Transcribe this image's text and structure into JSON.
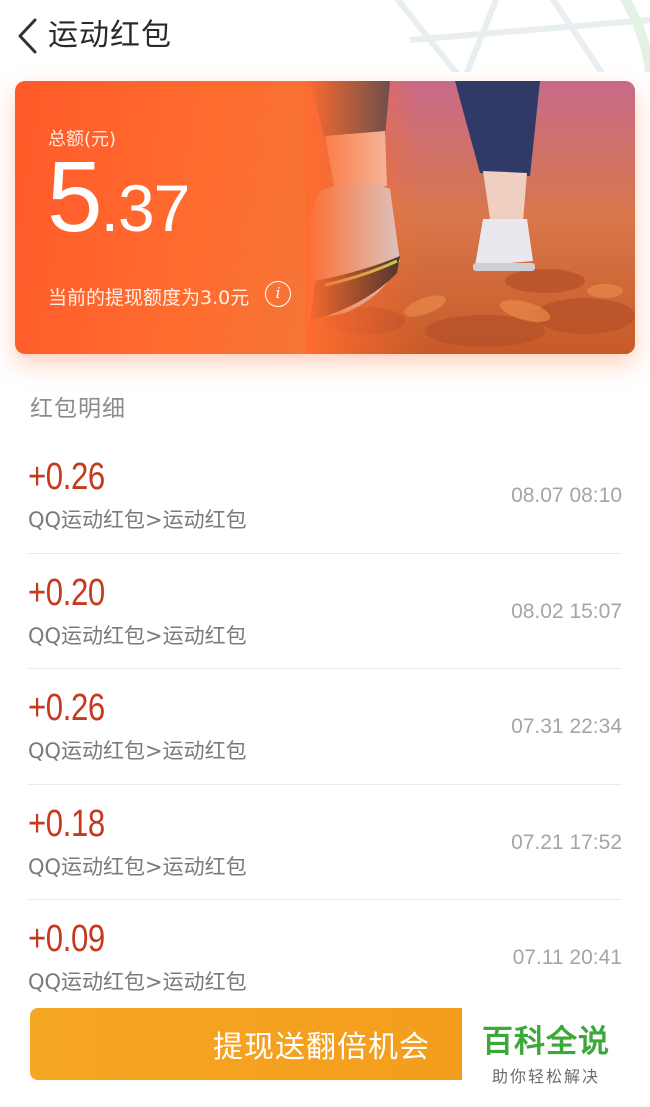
{
  "header": {
    "title": "运动红包",
    "back_icon": "chevron-left-icon"
  },
  "card": {
    "total_label": "总额(元)",
    "amount_int": "5",
    "amount_dec": ".37",
    "limit_text": "当前的提现额度为3.0元",
    "info_icon": "info-icon",
    "accent_color": "#ff5a2a"
  },
  "section": {
    "title": "红包明细"
  },
  "records": [
    {
      "amount": "+0.26",
      "source": "QQ运动红包>运动红包",
      "time": "08.07 08:10"
    },
    {
      "amount": "+0.20",
      "source": "QQ运动红包>运动红包",
      "time": "08.02 15:07"
    },
    {
      "amount": "+0.26",
      "source": "QQ运动红包>运动红包",
      "time": "07.31 22:34"
    },
    {
      "amount": "+0.18",
      "source": "QQ运动红包>运动红包",
      "time": "07.21 17:52"
    },
    {
      "amount": "+0.09",
      "source": "QQ运动红包>运动红包",
      "time": "07.11 20:41"
    }
  ],
  "button": {
    "withdraw_label": "提现送翻倍机会",
    "color": "#f5a623"
  },
  "watermark": {
    "logo": "百科全说",
    "sub": "助你轻松解决"
  }
}
